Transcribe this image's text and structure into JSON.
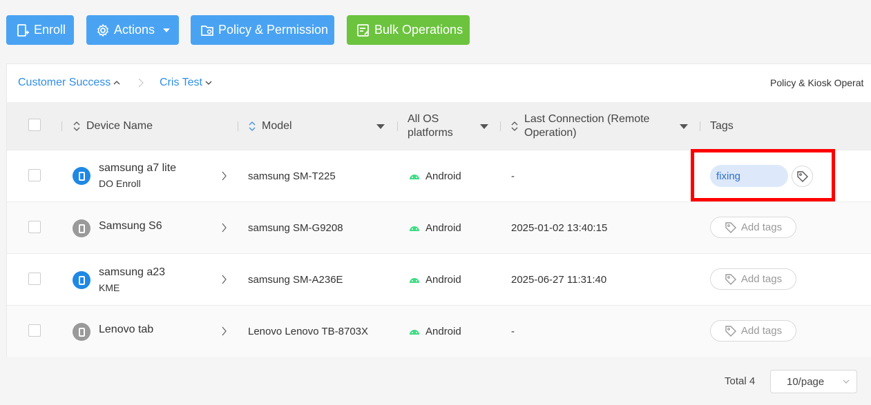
{
  "toolbar": {
    "enroll_label": "Enroll",
    "actions_label": "Actions",
    "policy_label": "Policy & Permission",
    "bulk_label": "Bulk Operations"
  },
  "breadcrumb": {
    "items": [
      "Customer Success",
      "Cris Test"
    ],
    "right_label": "Policy & Kiosk Operat"
  },
  "table": {
    "headers": {
      "device_name": "Device Name",
      "model": "Model",
      "os": "All OS platforms",
      "last_connection": "Last Connection (Remote Operation)",
      "tags": "Tags"
    },
    "rows": [
      {
        "name": "samsung a7 lite",
        "sub": "DO Enroll",
        "model": "samsung SM-T225",
        "os": "Android",
        "last": "-",
        "tag": "fixing",
        "status": "active"
      },
      {
        "name": "Samsung S6",
        "sub": "",
        "model": "samsung SM-G9208",
        "os": "Android",
        "last": "2025-01-02 13:40:15",
        "tag": "",
        "status": "inactive"
      },
      {
        "name": "samsung a23",
        "sub": "KME",
        "model": "samsung SM-A236E",
        "os": "Android",
        "last": "2025-06-27 11:31:40",
        "tag": "",
        "status": "active"
      },
      {
        "name": "Lenovo tab",
        "sub": "",
        "model": "Lenovo Lenovo TB-8703X",
        "os": "Android",
        "last": "-",
        "tag": "",
        "status": "inactive"
      }
    ],
    "add_tags_label": "Add tags"
  },
  "pagination": {
    "total_label": "Total 4",
    "page_size": "10/page"
  },
  "colors": {
    "primary": "#4aa3f2",
    "success": "#6cc33e",
    "link": "#2f8ee6",
    "highlight": "#ff0000",
    "android": "#3ddc84"
  }
}
